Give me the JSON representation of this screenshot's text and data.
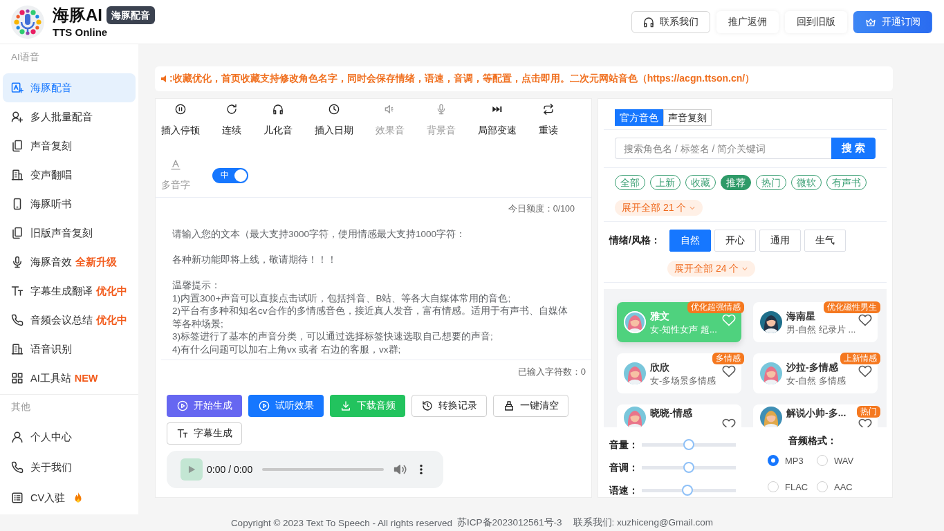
{
  "header": {
    "title": "海豚AI",
    "badge": "海豚配音",
    "subtitle": "TTS Online",
    "buttons": [
      {
        "label": "联系我们",
        "kind": "outline"
      },
      {
        "label": "推广返佣",
        "kind": "plain"
      },
      {
        "label": "回到旧版",
        "kind": "plain"
      },
      {
        "label": "开通订阅",
        "kind": "primary"
      }
    ]
  },
  "sidebar": {
    "sections": [
      {
        "title": "AI语音",
        "items": [
          {
            "label": "海豚配音",
            "selected": true
          },
          {
            "label": "多人批量配音",
            "selected": false
          },
          {
            "label": "声音复刻",
            "selected": false
          },
          {
            "label": "变声翻唱",
            "selected": false
          },
          {
            "label": "海豚听书",
            "selected": false
          },
          {
            "label": "旧版声音复刻",
            "selected": false
          },
          {
            "label": "海豚音效",
            "badge": "全新升级",
            "selected": false
          },
          {
            "label": "字幕生成翻译",
            "badge": "优化中",
            "selected": false
          },
          {
            "label": "音频会议总结",
            "badge": "优化中",
            "selected": false
          },
          {
            "label": "语音识别",
            "selected": false
          },
          {
            "label": "AI工具站",
            "badge": "NEW",
            "selected": false
          }
        ]
      },
      {
        "title": "其他",
        "items": [
          {
            "label": "个人中心",
            "selected": false
          },
          {
            "label": "关于我们",
            "selected": false
          },
          {
            "label": "CV入驻",
            "selected": false
          }
        ]
      }
    ]
  },
  "notice": ":收藏优化，首页收藏支持修改角色名字，同时会保存情绪，语速，音调，等配置，点击即用。二次元网站音色（https://acgn.ttson.cn/）",
  "editor": {
    "tools": [
      {
        "label": "插入停顿",
        "disabled": false
      },
      {
        "label": "连续",
        "disabled": false
      },
      {
        "label": "儿化音",
        "disabled": false
      },
      {
        "label": "插入日期",
        "disabled": false
      },
      {
        "label": "效果音",
        "disabled": true
      },
      {
        "label": "背景音",
        "disabled": true
      },
      {
        "label": "局部变速",
        "disabled": false
      },
      {
        "label": "重读",
        "disabled": false
      }
    ],
    "polyphone": {
      "label": "多音字",
      "disabled": true,
      "switch": {
        "on": true,
        "text": "中"
      }
    },
    "quota": "今日额度：0/100",
    "placeholder": [
      [
        "请输入您的文本（最大支持3000字符，使用情感最大支持1000字符："
      ],
      [
        "各种新功能即将上线，敬请期待！！！"
      ],
      [
        "温馨提示：",
        "1)内置300+声音可以直接点击试听，包括抖音、B站、等各大自媒体常用的音色;",
        "2)平台有多种和知名cv合作的多情感音色，接近真人发音，富有情感。适用于有声书、自媒体等各种场景;",
        "3)标签进行了基本的声音分类，可以通过选择标签快速选取自己想要的声音;",
        "4)有什么问题可以加右上角vx 或者 右边的客服，vx群;"
      ]
    ],
    "char_count": "已输入字符数：0",
    "buttons": [
      {
        "label": "开始生成",
        "kind": "primary"
      },
      {
        "label": "试听效果",
        "kind": "info"
      },
      {
        "label": "下载音频",
        "kind": "success"
      },
      {
        "label": "转换记录",
        "kind": "plain"
      },
      {
        "label": "一键清空",
        "kind": "plain"
      },
      {
        "label": "字幕生成",
        "kind": "plain"
      }
    ],
    "player": {
      "time": "0:00 / 0:00"
    }
  },
  "voice_panel": {
    "tabs": [
      {
        "label": "官方音色",
        "selected": true
      },
      {
        "label": "声音复刻",
        "selected": false
      }
    ],
    "search": {
      "placeholder": "搜索角色名 / 标签名 / 简介关键词",
      "button": "搜 索"
    },
    "tags": [
      {
        "label": "全部",
        "selected": false
      },
      {
        "label": "上新",
        "selected": false
      },
      {
        "label": "收藏",
        "selected": false
      },
      {
        "label": "推荐",
        "selected": true
      },
      {
        "label": "热门",
        "selected": false
      },
      {
        "label": "微软",
        "selected": false
      },
      {
        "label": "有声书",
        "selected": false
      }
    ],
    "tags_expand": "展开全部 21 个",
    "emotion_label": "情绪/风格：",
    "emotions": [
      {
        "label": "自然",
        "selected": true
      },
      {
        "label": "开心",
        "selected": false
      },
      {
        "label": "通用",
        "selected": false
      },
      {
        "label": "生气",
        "selected": false
      }
    ],
    "emotions_expand": "展开全部 24 个",
    "voices": [
      {
        "name": "雅文",
        "desc": "女-知性女声 超...",
        "tag": "优化超强情感",
        "selected": true
      },
      {
        "name": "海南星",
        "desc": "男-自然 纪录片 ...",
        "tag": "优化磁性男生",
        "selected": false
      },
      {
        "name": "欣欣",
        "desc": "女-多场景多情感",
        "tag": "多情感",
        "selected": false
      },
      {
        "name": "沙拉-多情感",
        "desc": "女-自然 多情感",
        "tag": "上新情感",
        "selected": false
      },
      {
        "name": "晓晓-情感",
        "selected": false
      },
      {
        "name": "解说小帅-多...",
        "tag": "热门",
        "selected": false
      }
    ],
    "sliders": [
      {
        "label": "音量：",
        "level": 0.5
      },
      {
        "label": "音调：",
        "level": 0.5
      },
      {
        "label": "语速：",
        "level": 0.48
      }
    ],
    "format_label": "音频格式：",
    "formats": [
      {
        "label": "MP3",
        "selected": true
      },
      {
        "label": "WAV",
        "selected": false
      },
      {
        "label": "FLAC",
        "selected": false
      },
      {
        "label": "AAC",
        "selected": false
      }
    ]
  },
  "footer": {
    "copyright": "Copyright © 2023 Text To Speech - All rights reserved",
    "icp": "苏ICP备2023012561号-3",
    "contact": "联系我们: xuzhiceng@Gmail.com"
  }
}
